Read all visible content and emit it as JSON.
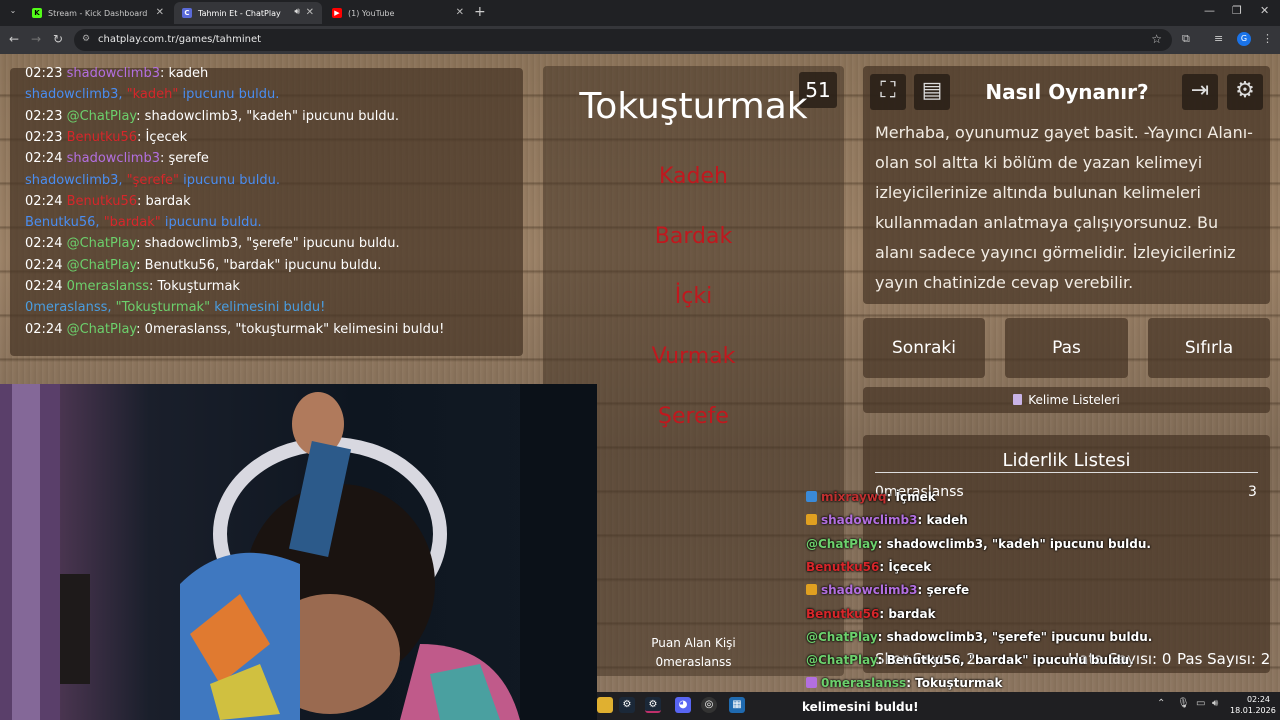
{
  "browser": {
    "tabs": [
      {
        "title": "Stream - Kick Dashboard",
        "icon": "kick-icon",
        "active": false
      },
      {
        "title": "Tahmin Et - ChatPlay",
        "icon": "chatplay-icon",
        "active": true
      },
      {
        "title": "(1) YouTube",
        "icon": "youtube-icon",
        "active": false
      }
    ],
    "url": "chatplay.com.tr/games/tahminet",
    "profile_initial": "G"
  },
  "chat_log": [
    {
      "time": "02:23",
      "user": "shadowclimb3",
      "user_color": "purple",
      "sep": ": ",
      "msg": "kadeh"
    },
    {
      "time": "",
      "user": "shadowclimb3,",
      "user_color": "blue",
      "sep": " ",
      "hint": "\"kadeh\"",
      "msg": " ipucunu buldu."
    },
    {
      "time": "02:23",
      "user": "@ChatPlay",
      "user_color": "green",
      "sep": ": ",
      "msg": "shadowclimb3, \"kadeh\" ipucunu buldu."
    },
    {
      "time": "02:23",
      "user": "Benutku56",
      "user_color": "red",
      "sep": ": ",
      "msg": "İçecek"
    },
    {
      "time": "02:24",
      "user": "shadowclimb3",
      "user_color": "purple",
      "sep": ": ",
      "msg": "şerefe"
    },
    {
      "time": "",
      "user": "shadowclimb3,",
      "user_color": "blue",
      "sep": " ",
      "hint": "\"şerefe\"",
      "msg": " ipucunu buldu."
    },
    {
      "time": "02:24",
      "user": "Benutku56",
      "user_color": "red",
      "sep": ": ",
      "msg": "bardak"
    },
    {
      "time": "",
      "user": "Benutku56,",
      "user_color": "blue",
      "sep": " ",
      "hint": "\"bardak\"",
      "msg": " ipucunu buldu."
    },
    {
      "time": "02:24",
      "user": "@ChatPlay",
      "user_color": "green",
      "sep": ": ",
      "msg": "shadowclimb3, \"şerefe\" ipucunu buldu."
    },
    {
      "time": "02:24",
      "user": "@ChatPlay",
      "user_color": "green",
      "sep": ": ",
      "msg": "Benutku56, \"bardak\" ipucunu buldu."
    },
    {
      "time": "02:24",
      "user": "0meraslanss",
      "user_color": "green",
      "sep": ": ",
      "msg": "Tokuşturmak"
    },
    {
      "time": "",
      "user": "0meraslanss,",
      "user_color": "teal",
      "sep": " ",
      "hint": "\"Tokuşturmak\"",
      "msg": " kelimesini buldu!"
    },
    {
      "time": "02:24",
      "user": "@ChatPlay",
      "user_color": "green",
      "sep": ": ",
      "msg": "0meraslanss, \"tokuşturmak\" kelimesini buldu!"
    }
  ],
  "game": {
    "timer": "51",
    "word": "Tokuşturmak",
    "forbidden_words": [
      "Kadeh",
      "Bardak",
      "İçki",
      "Vurmak",
      "Şerefe"
    ],
    "scorer_label": "Puan Alan Kişi",
    "scorer_name": "0meraslanss"
  },
  "howto": {
    "title": "Nasıl Oynanır?",
    "text": "Merhaba, oyunumuz gayet basit. -Yayıncı Alanı- olan sol altta ki bölüm de yazan kelimeyi izleyicilerinize altında bulunan kelimeleri kullanmadan anlatmaya çalışıyorsunuz. Bu alanı sadece yayıncı görmelidir. İzleyicileriniz yayın chatinizde cevap verebilir."
  },
  "actions": {
    "next": "Sonraki",
    "pass": "Pas",
    "reset": "Sıfırla",
    "word_lists": "Kelime Listeleri"
  },
  "leaderboard": {
    "title": "Liderlik Listesi",
    "entries": [
      {
        "name": "0meraslanss",
        "score": "3"
      }
    ],
    "score_label": "Skor Sayısı: 2",
    "error_label": "Hata Sayısı: 0",
    "pass_label": "Pas Sayısı: 2"
  },
  "stream_overlay": [
    {
      "badge": "mod",
      "user": "mixraywq",
      "user_color": "#c03030",
      "msg": ": İçmek"
    },
    {
      "badge": "crown",
      "user": "shadowclimb3",
      "user_color": "#b36fe0",
      "msg": ": kadeh"
    },
    {
      "badge": "",
      "user": "@ChatPlay",
      "user_color": "#6cd06c",
      "msg": ": shadowclimb3, \"kadeh\" ipucunu buldu."
    },
    {
      "badge": "",
      "user": "Benutku56",
      "user_color": "#d6262a",
      "msg": ": İçecek"
    },
    {
      "badge": "crown",
      "user": "shadowclimb3",
      "user_color": "#b36fe0",
      "msg": ": şerefe"
    },
    {
      "badge": "",
      "user": "Benutku56",
      "user_color": "#d6262a",
      "msg": ": bardak"
    },
    {
      "badge": "",
      "user": "@ChatPlay",
      "user_color": "#6cd06c",
      "msg": ": shadowclimb3, \"şerefe\" ipucunu buldu."
    },
    {
      "badge": "",
      "user": "@ChatPlay",
      "user_color": "#6cd06c",
      "msg": ": Benutku56, \"bardak\" ipucunu buldu."
    },
    {
      "badge": "mic",
      "user": "0meraslanss",
      "user_color": "#6cd06c",
      "msg": ": Tokuşturmak"
    }
  ],
  "taskbar": {
    "ticker": "kelimesini buldu!",
    "time": "02:24",
    "date": "18.01.2026"
  }
}
